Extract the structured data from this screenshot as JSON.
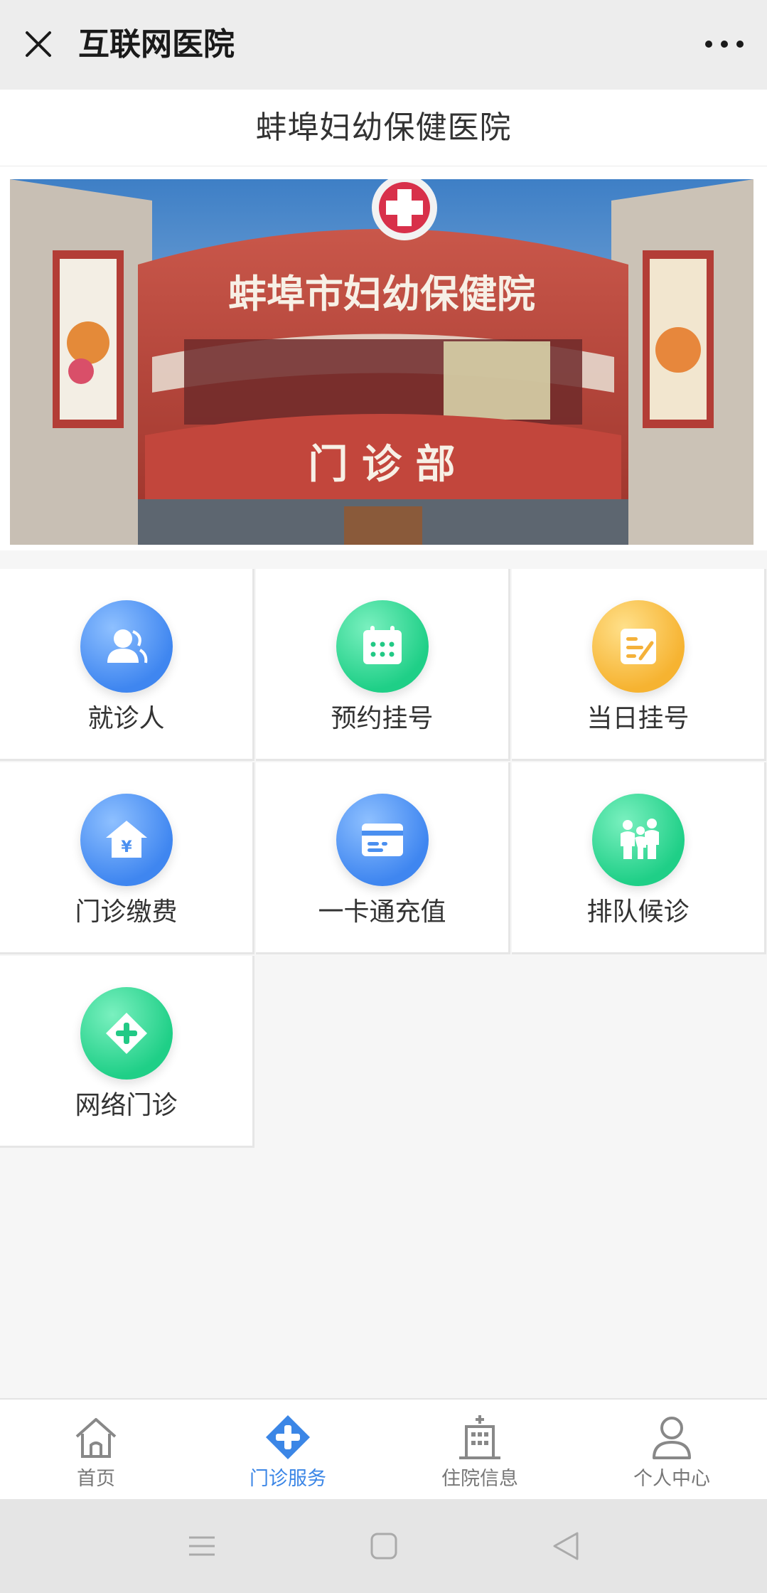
{
  "window": {
    "title": "互联网医院",
    "close_icon": "close-icon",
    "more_icon": "more-dots-icon"
  },
  "hospital": {
    "name": "蚌埠妇幼保健医院"
  },
  "banner": {
    "sign_main": "蚌埠市妇幼保健院",
    "sign_sub": "门 诊 部"
  },
  "services": [
    {
      "label": "就诊人",
      "icon": "patient-icon",
      "color": "#3f86f0"
    },
    {
      "label": "预约挂号",
      "icon": "calendar-icon",
      "color": "#1fcf87"
    },
    {
      "label": "当日挂号",
      "icon": "note-edit-icon",
      "color": "#f6b331"
    },
    {
      "label": "门诊缴费",
      "icon": "payment-house-icon",
      "color": "#3f86f0"
    },
    {
      "label": "一卡通充值",
      "icon": "card-icon",
      "color": "#3f86f0"
    },
    {
      "label": "排队候诊",
      "icon": "queue-people-icon",
      "color": "#1fcf87"
    },
    {
      "label": "网络门诊",
      "icon": "plus-icon",
      "color": "#1fcf87"
    }
  ],
  "tabbar": [
    {
      "label": "首页",
      "icon": "home-icon",
      "active": false
    },
    {
      "label": "门诊服务",
      "icon": "medical-cross-icon",
      "active": true
    },
    {
      "label": "住院信息",
      "icon": "hospital-building-icon",
      "active": false
    },
    {
      "label": "个人中心",
      "icon": "user-icon",
      "active": false
    }
  ],
  "colors": {
    "accent": "#3b86e6",
    "tab_inactive": "#777777"
  }
}
